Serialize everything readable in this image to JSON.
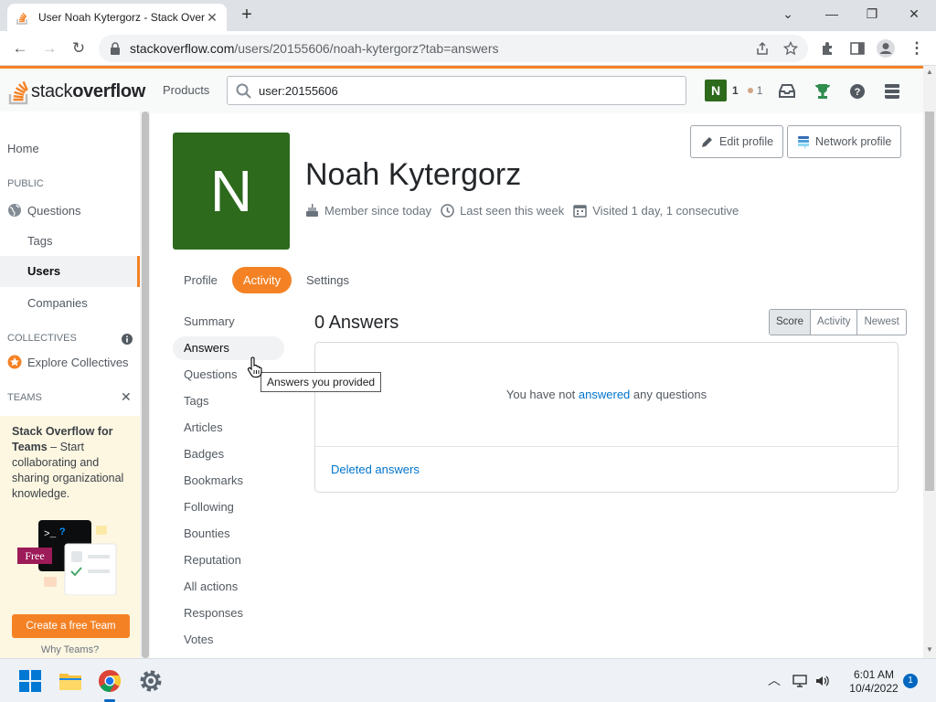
{
  "browser": {
    "tab_title": "User Noah Kytergorz - Stack Overflow",
    "url_host": "stackoverflow.com",
    "url_path": "/users/20155606/noah-kytergorz?tab=answers"
  },
  "header": {
    "logo_stack": "stack",
    "logo_overflow": "overflow",
    "products_label": "Products",
    "search_value": "user:20155606",
    "user_initial": "N",
    "reputation": "1",
    "bronze_badges": "1"
  },
  "sidebar": {
    "home": "Home",
    "public_heading": "PUBLIC",
    "questions": "Questions",
    "tags": "Tags",
    "users": "Users",
    "companies": "Companies",
    "collectives_heading": "COLLECTIVES",
    "explore_collectives": "Explore Collectives",
    "teams_heading": "TEAMS",
    "teams_promo_bold": "Stack Overflow for Teams",
    "teams_promo_rest": " – Start collaborating and sharing organizational knowledge.",
    "free_badge": "Free",
    "create_team_button": "Create a free Team",
    "why_teams": "Why Teams?"
  },
  "profile": {
    "avatar_initial": "N",
    "name": "Noah Kytergorz",
    "member_since": "Member since today",
    "last_seen": "Last seen this week",
    "visited": "Visited 1 day, 1 consecutive",
    "edit_profile_button": "Edit profile",
    "network_profile_button": "Network profile",
    "tabs": [
      "Profile",
      "Activity",
      "Settings"
    ],
    "active_tab": "Activity"
  },
  "activity_nav": [
    "Summary",
    "Answers",
    "Questions",
    "Tags",
    "Articles",
    "Badges",
    "Bookmarks",
    "Following",
    "Bounties",
    "Reputation",
    "All actions",
    "Responses",
    "Votes"
  ],
  "answers": {
    "heading": "0 Answers",
    "sort_options": [
      "Score",
      "Activity",
      "Newest"
    ],
    "selected_sort": "Score",
    "empty_prefix": "You have not ",
    "empty_link": "answered",
    "empty_suffix": " any questions",
    "deleted_link": "Deleted answers"
  },
  "tooltip": "Answers you provided",
  "taskbar": {
    "time": "6:01 AM",
    "date": "10/4/2022",
    "notification_count": "1"
  },
  "colors": {
    "accent": "#f48225",
    "avatar_bg": "#2d6a1c",
    "link": "#0074cc"
  }
}
